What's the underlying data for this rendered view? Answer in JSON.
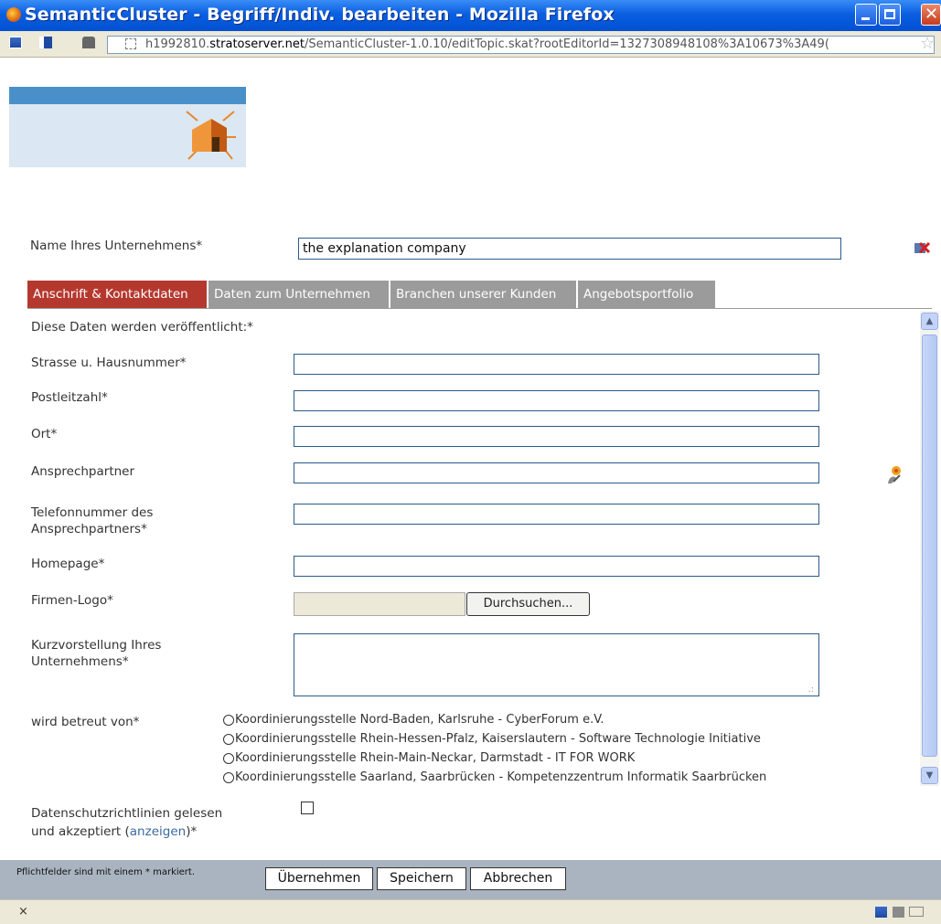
{
  "window": {
    "title": "SemanticCluster - Begriff/Indiv. bearbeiten - Mozilla Firefox",
    "url_host": "h1992810.stratoserver.net",
    "url_prefix": "h1992810.",
    "url_domain": "stratoserver.net",
    "url_path": "/SemanticCluster-1.0.10/editTopic.skat?rootEditorId=1327308948108%3A10673%3A49("
  },
  "company": {
    "label": "Name Ihres Unternehmens*",
    "value": "the explanation company"
  },
  "tabs": [
    {
      "label": "Anschrift & Kontaktdaten",
      "active": true
    },
    {
      "label": "Daten zum Unternehmen",
      "active": false
    },
    {
      "label": "Branchen unserer Kunden",
      "active": false
    },
    {
      "label": "Angebotsportfolio",
      "active": false
    }
  ],
  "form": {
    "intro": "Diese Daten werden veröffentlicht:*",
    "street": "Strasse u. Hausnummer*",
    "zip": "Postleitzahl*",
    "city": "Ort*",
    "contact": "Ansprechpartner",
    "phone_line1": "Telefonnummer des",
    "phone_line2": "Ansprechpartners*",
    "homepage": "Homepage*",
    "logo": "Firmen-Logo*",
    "browse": "Durchsuchen...",
    "intro_line1": "Kurzvorstellung Ihres",
    "intro_line2": "Unternehmens*",
    "supervised": "wird betreut von*",
    "options": [
      "Koordinierungsstelle Nord-Baden, Karlsruhe - CyberForum e.V.",
      "Koordinierungsstelle Rhein-Hessen-Pfalz, Kaiserslautern - Software Technologie Initiative",
      "Koordinierungsstelle Rhein-Main-Neckar, Darmstadt - IT FOR WORK",
      "Koordinierungsstelle Saarland, Saarbrücken - Kompetenzzentrum Informatik Saarbrücken"
    ],
    "privacy_line1": "Datenschutzrichtlinien gelesen",
    "privacy_line2_a": "und akzeptiert (",
    "privacy_link": "anzeigen",
    "privacy_line2_b": ")*"
  },
  "footer": {
    "note": "Pflichtfelder sind mit einem * markiert.",
    "apply": "Übernehmen",
    "save": "Speichern",
    "cancel": "Abbrechen"
  },
  "statusbar": {
    "close": "×"
  },
  "colors": {
    "active_tab": "#b5382f",
    "inactive_tab": "#9b9b9b",
    "link": "#3a6aa0"
  }
}
